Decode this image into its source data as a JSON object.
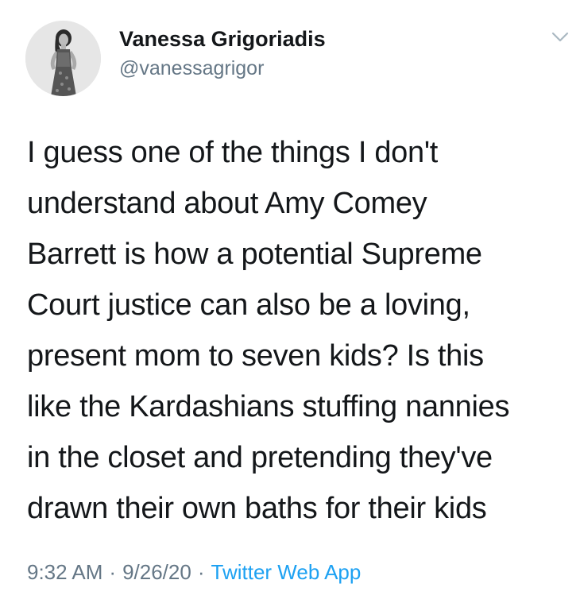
{
  "user": {
    "display_name": "Vanessa Grigoriadis",
    "handle": "@vanessagrigor"
  },
  "tweet": {
    "lines": [
      "I guess one of the things I don't",
      "understand about Amy Comey",
      "Barrett is how a potential Supreme",
      "Court justice can also be a loving,",
      "present mom to seven kids? Is this",
      "like the Kardashians stuffing nannies",
      "in the closet and pretending they've",
      "drawn their own baths for their kids"
    ]
  },
  "meta": {
    "time": "9:32 AM",
    "date": "9/26/20",
    "separator": "·",
    "source": "Twitter Web App"
  },
  "icons": {
    "caret": "chevron-down-icon"
  },
  "colors": {
    "text": "#14171a",
    "secondary": "#657786",
    "link": "#1da1f2",
    "background": "#ffffff"
  }
}
